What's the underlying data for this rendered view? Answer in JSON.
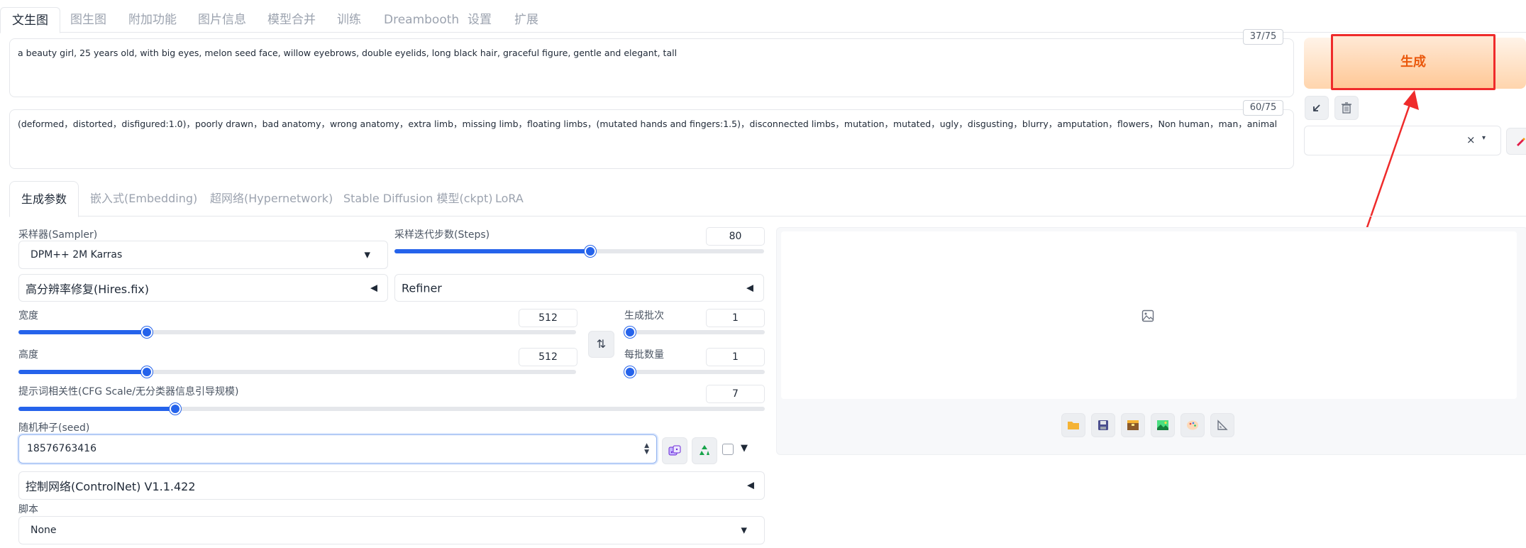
{
  "top_tabs": [
    "文生图",
    "图生图",
    "附加功能",
    "图片信息",
    "模型合并",
    "训练",
    "Dreambooth",
    "设置",
    "扩展"
  ],
  "prompt": {
    "positive": "a beauty girl, 25 years old, with big eyes, melon seed face, willow eyebrows, double eyelids, long black hair, graceful figure, gentle and elegant, tall",
    "positive_count": "37/75",
    "negative": "(deformed，distorted，disfigured:1.0)，poorly drawn，bad anatomy，wrong anatomy，extra limb，missing limb，floating limbs，(mutated hands and fingers:1.5)，disconnected limbs，mutation，mutated，ugly，disgusting，blurry，amputation，flowers，Non human，man，animal",
    "negative_count": "60/75"
  },
  "generate": {
    "label": "生成"
  },
  "style_select": {
    "clear": "×",
    "caret": "▾"
  },
  "param_tabs": [
    "生成参数",
    "嵌入式(Embedding)",
    "超网络(Hypernetwork)",
    "Stable Diffusion 模型(ckpt)",
    "LoRA"
  ],
  "sampler": {
    "label": "采样器(Sampler)",
    "value": "DPM++ 2M Karras"
  },
  "steps": {
    "label": "采样迭代步数(Steps)",
    "value": "80",
    "fraction": 0.53
  },
  "hires": {
    "label": "高分辨率修复(Hires.fix)"
  },
  "refiner": {
    "label": "Refiner"
  },
  "width": {
    "label": "宽度",
    "value": "512",
    "fraction": 0.23
  },
  "height": {
    "label": "高度",
    "value": "512",
    "fraction": 0.23
  },
  "batch_count": {
    "label": "生成批次",
    "value": "1",
    "fraction": 0.0
  },
  "batch_size": {
    "label": "每批数量",
    "value": "1",
    "fraction": 0.0
  },
  "cfg": {
    "label": "提示词相关性(CFG Scale/无分类器信息引导规模)",
    "value": "7",
    "fraction": 0.21
  },
  "seed": {
    "label": "随机种子(seed)",
    "value": "18576763416"
  },
  "controlnet": {
    "label": "控制网络(ControlNet) V1.1.422"
  },
  "script": {
    "label": "脚本",
    "value": "None"
  },
  "icons": {
    "accordion_arrow": "◀",
    "dropdown_arrow": "▼",
    "swap": "⇅",
    "seed_extra": "▼"
  },
  "colors": {
    "accent": "#2563eb",
    "generate_text": "#ea580c",
    "highlight_box": "#ef2b2b"
  }
}
